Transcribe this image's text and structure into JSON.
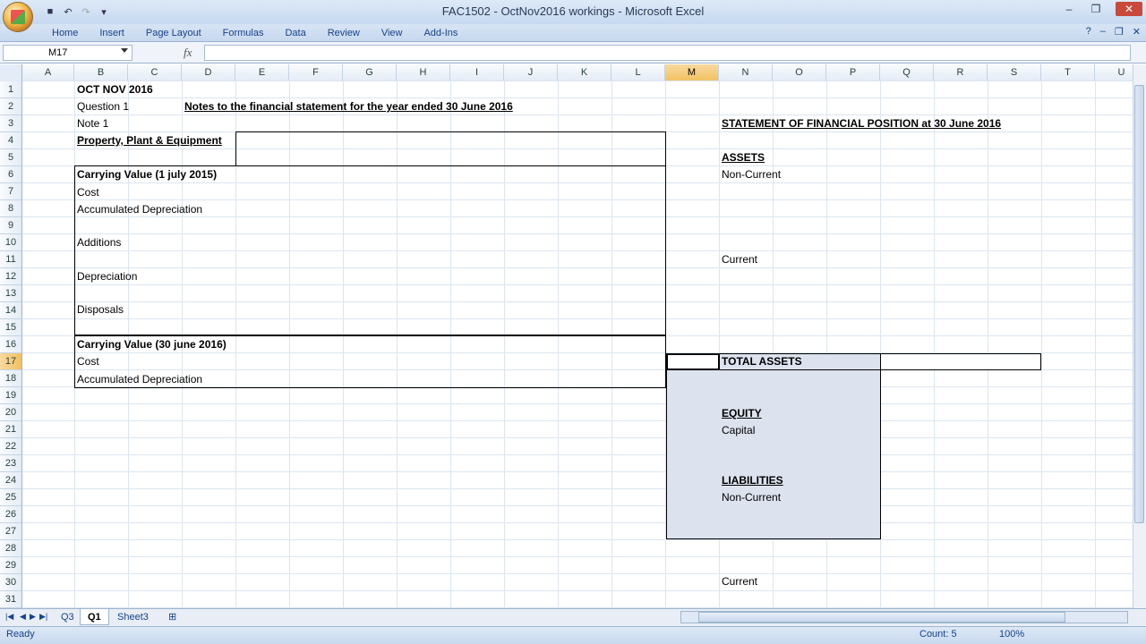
{
  "window": {
    "title": "FAC1502 - OctNov2016 workings - Microsoft Excel"
  },
  "ribbon": {
    "tabs": [
      "Home",
      "Insert",
      "Page Layout",
      "Formulas",
      "Data",
      "Review",
      "View",
      "Add-Ins"
    ]
  },
  "formula_bar": {
    "name_box": "M17",
    "fx": "fx",
    "value": ""
  },
  "columns": [
    "A",
    "B",
    "C",
    "D",
    "E",
    "F",
    "G",
    "H",
    "I",
    "J",
    "K",
    "L",
    "M",
    "N",
    "O",
    "P",
    "Q",
    "R",
    "S",
    "T",
    "U"
  ],
  "selected_column": "M",
  "rows": [
    "1",
    "2",
    "3",
    "4",
    "5",
    "6",
    "7",
    "8",
    "9",
    "10",
    "11",
    "12",
    "13",
    "14",
    "15",
    "16",
    "17",
    "18",
    "19",
    "20",
    "21",
    "22",
    "23",
    "24",
    "25",
    "26",
    "27",
    "28",
    "29",
    "30",
    "31"
  ],
  "selected_row": "17",
  "cells": {
    "b1": "OCT NOV 2016",
    "b2": "Question 1",
    "e2": "Notes to the financial statement for the year ended 30 June 2016",
    "b3": "Note 1",
    "b4": "Property, Plant & Equipment",
    "b6": "Carrying Value (1 july 2015)",
    "b7": "Cost",
    "b8": "Accumulated Depreciation",
    "b10": "Additions",
    "b12": "Depreciation",
    "b14": "Disposals",
    "b16": "Carrying Value (30 june 2016)",
    "b17": "Cost",
    "b18": "Accumulated Depreciation",
    "n3": "STATEMENT OF FINANCIAL POSITION at 30 June 2016",
    "n5": "ASSETS",
    "n6": "Non-Current",
    "n11": "Current",
    "n17": "TOTAL ASSETS",
    "n20": "EQUITY",
    "n21": "Capital",
    "n24": "LIABILITIES",
    "n25": "Non-Current",
    "n30": "Current"
  },
  "sheets": {
    "tabs": [
      "Q3",
      "Q1",
      "Sheet3"
    ],
    "active": "Q1"
  },
  "status": {
    "mode": "Ready",
    "count": "Count: 5",
    "zoom": "100%"
  },
  "colors": {
    "selected_header": "#f1c15f",
    "shade": "#dce3ee",
    "ribbon_text": "#15428b"
  }
}
